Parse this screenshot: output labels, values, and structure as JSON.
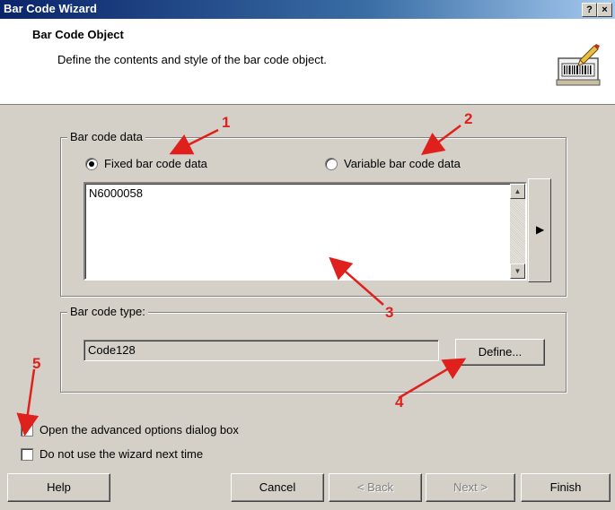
{
  "window": {
    "title": "Bar Code Wizard",
    "help_btn": "?",
    "close_btn": "×"
  },
  "header": {
    "title": "Bar Code Object",
    "subtitle": "Define the contents and style of the bar code object.",
    "icon": "barcode-icon"
  },
  "barcode_data": {
    "label": "Bar code data",
    "fixed_radio_label": "Fixed bar code data",
    "fixed_selected": true,
    "variable_radio_label": "Variable bar code data",
    "variable_selected": false,
    "value": "N6000058",
    "expand_button_icon": "triangle-right-icon"
  },
  "barcode_type": {
    "label": "Bar code type:",
    "value": "Code128",
    "define_button": "Define..."
  },
  "options": {
    "advanced_label": "Open the advanced options dialog box",
    "advanced_checked": false,
    "no_wizard_label": "Do not use the wizard next time",
    "no_wizard_checked": false
  },
  "buttons": {
    "help": "Help",
    "cancel": "Cancel",
    "back": "< Back",
    "next": "Next >",
    "finish": "Finish"
  },
  "annotations": [
    "1",
    "2",
    "3",
    "4",
    "5"
  ],
  "colors": {
    "annotation": "#e0201c",
    "dialog": "#d4d0c8",
    "titlebar": "#0a246a"
  }
}
